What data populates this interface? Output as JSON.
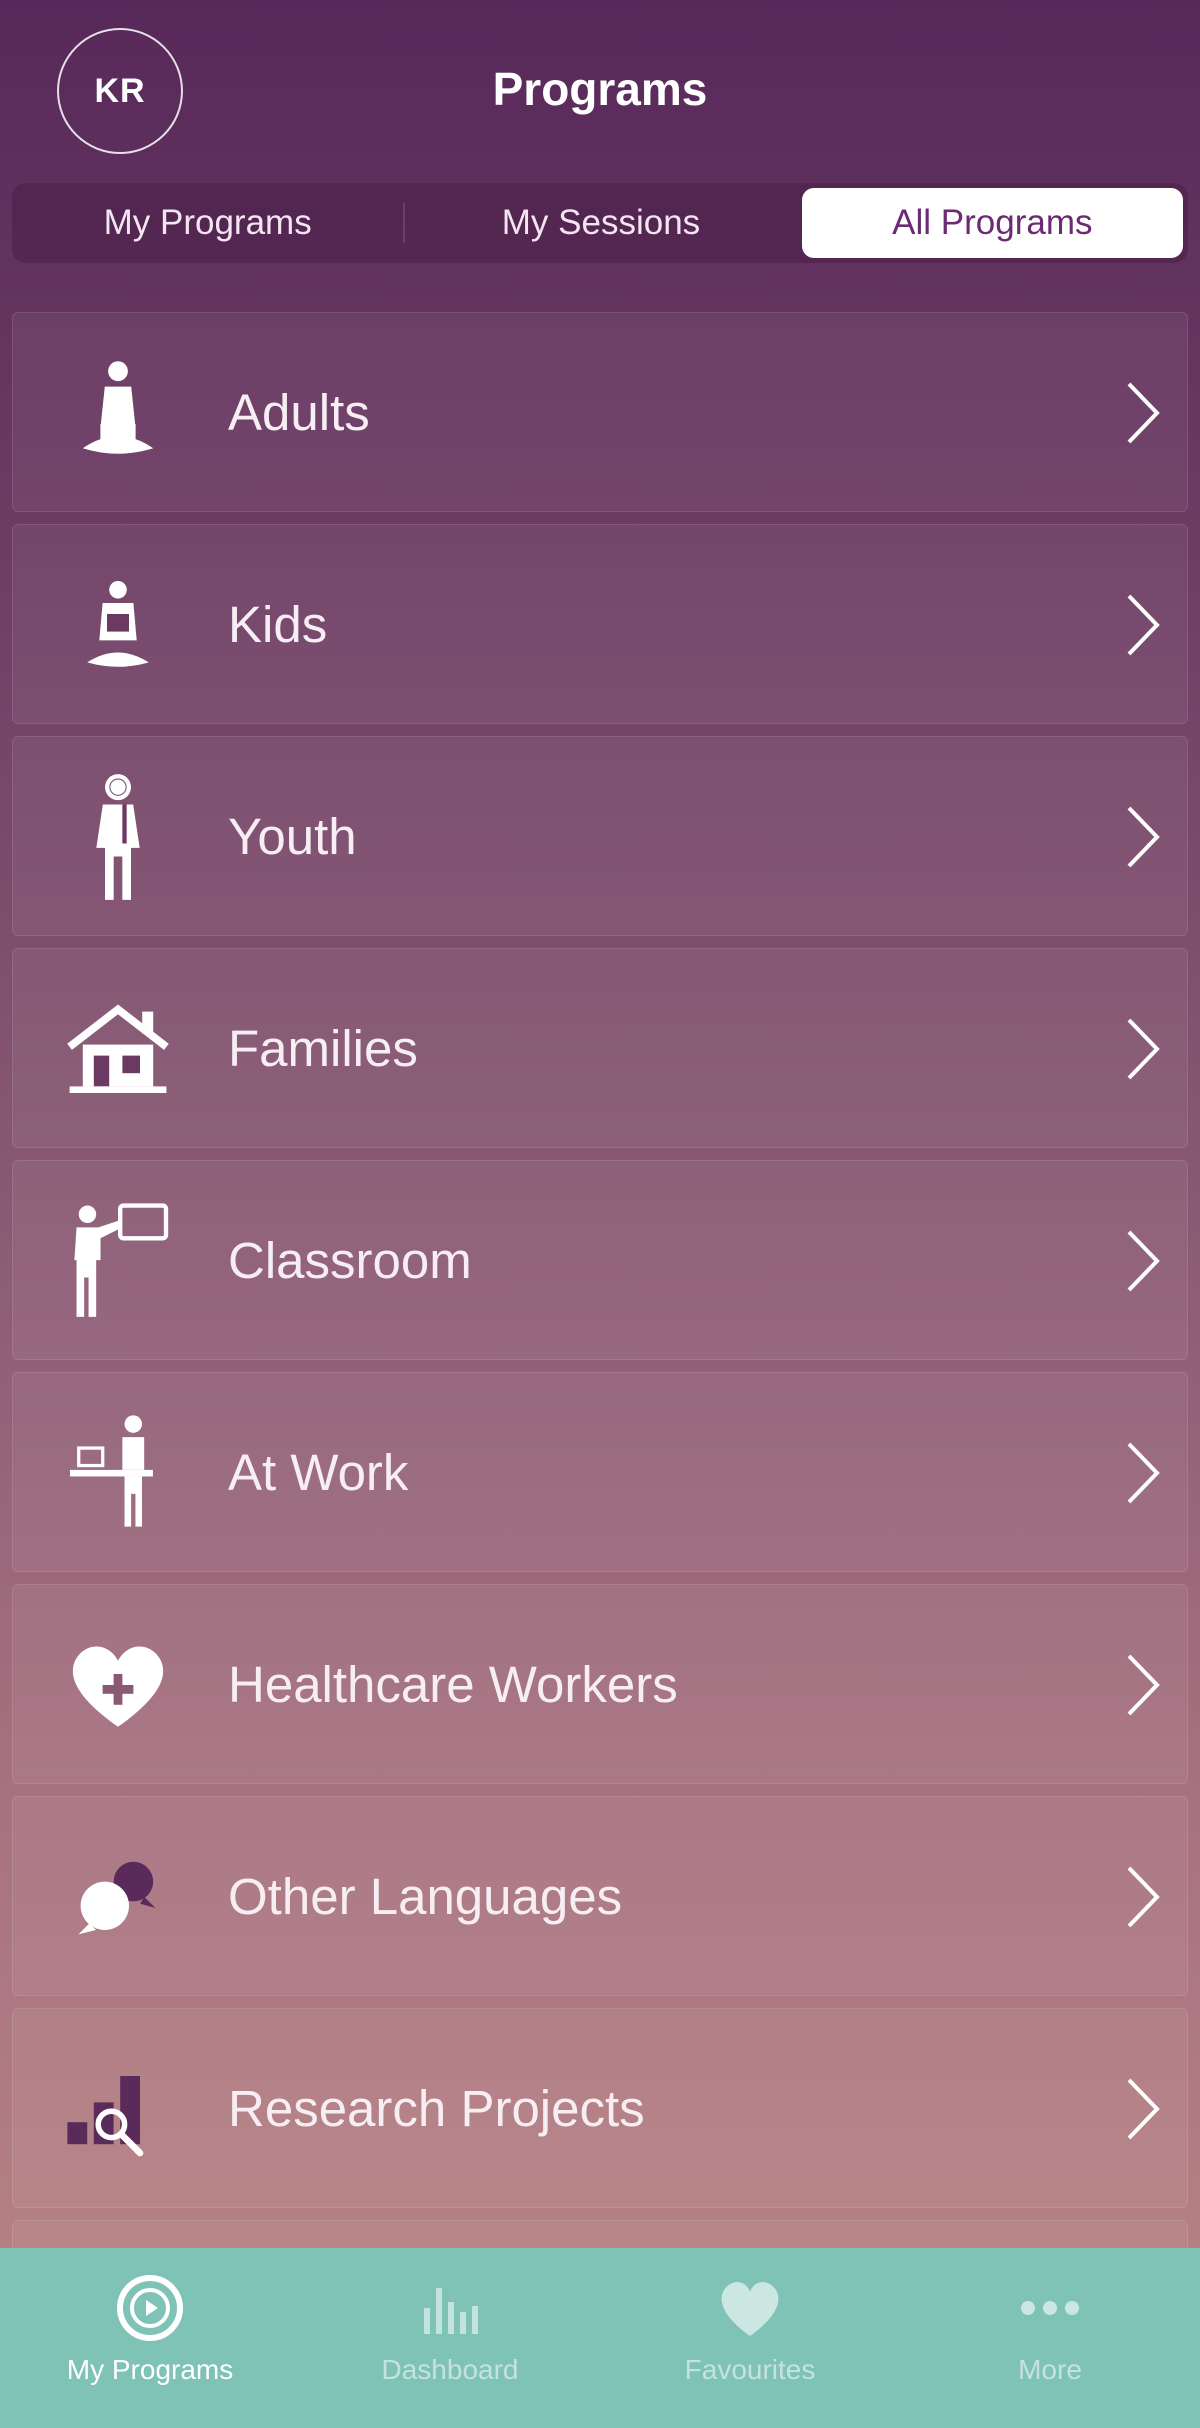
{
  "header": {
    "avatar_initials": "KR",
    "title": "Programs"
  },
  "segments": {
    "items": [
      {
        "label": "My Programs",
        "active": false
      },
      {
        "label": "My Sessions",
        "active": false
      },
      {
        "label": "All Programs",
        "active": true
      }
    ]
  },
  "programs": [
    {
      "label": "Adults",
      "icon": "meditating-adult-icon"
    },
    {
      "label": "Kids",
      "icon": "meditating-kid-icon"
    },
    {
      "label": "Youth",
      "icon": "teen-with-headphones-icon"
    },
    {
      "label": "Families",
      "icon": "house-icon"
    },
    {
      "label": "Classroom",
      "icon": "teacher-board-icon"
    },
    {
      "label": "At Work",
      "icon": "desk-worker-icon"
    },
    {
      "label": "Healthcare Workers",
      "icon": "heart-plus-icon"
    },
    {
      "label": "Other Languages",
      "icon": "speech-bubbles-icon"
    },
    {
      "label": "Research Projects",
      "icon": "chart-magnifier-icon"
    }
  ],
  "tabbar": {
    "items": [
      {
        "label": "My Programs",
        "icon": "play-circle-icon",
        "active": true
      },
      {
        "label": "Dashboard",
        "icon": "bars-icon",
        "active": false
      },
      {
        "label": "Favourites",
        "icon": "heart-icon",
        "active": false
      },
      {
        "label": "More",
        "icon": "more-dots-icon",
        "active": false
      }
    ]
  },
  "colors": {
    "accent": "#6a2b73",
    "tabbar": "#7fc2b6",
    "header": "#57295a"
  }
}
